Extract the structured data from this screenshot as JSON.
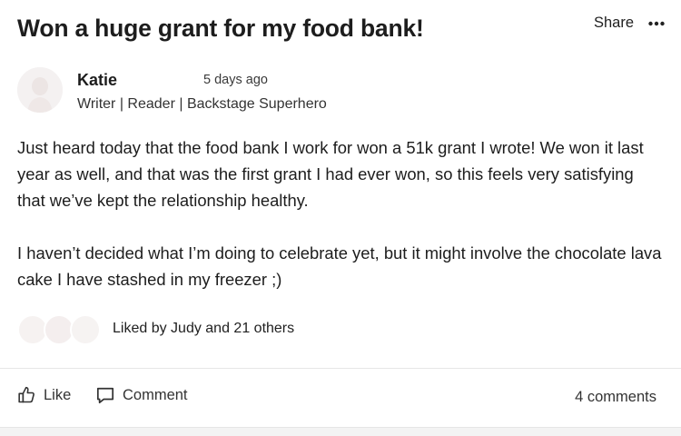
{
  "post": {
    "title": "Won a huge grant for my food bank!",
    "share_label": "Share",
    "more_icon": "more-horizontal-icon"
  },
  "author": {
    "name": "Katie",
    "time": "5 days ago",
    "bio": "Writer | Reader | Backstage Superhero"
  },
  "body": {
    "paragraphs": [
      "Just heard today that the food bank I work for won a 51k grant I wrote! We won it last year as well, and that was the first grant I had ever won, so this feels very satisfying that we’ve kept the relationship healthy.",
      "I haven’t decided what I’m doing to celebrate yet, but it might involve the chocolate lava cake I have stashed in my freezer ;)"
    ]
  },
  "likes": {
    "text": "Liked by Judy and 21 others"
  },
  "actions": {
    "like_label": "Like",
    "like_icon": "thumbs-up-icon",
    "comment_label": "Comment",
    "comment_icon": "comment-bubble-icon",
    "comments_count": "4 comments"
  }
}
